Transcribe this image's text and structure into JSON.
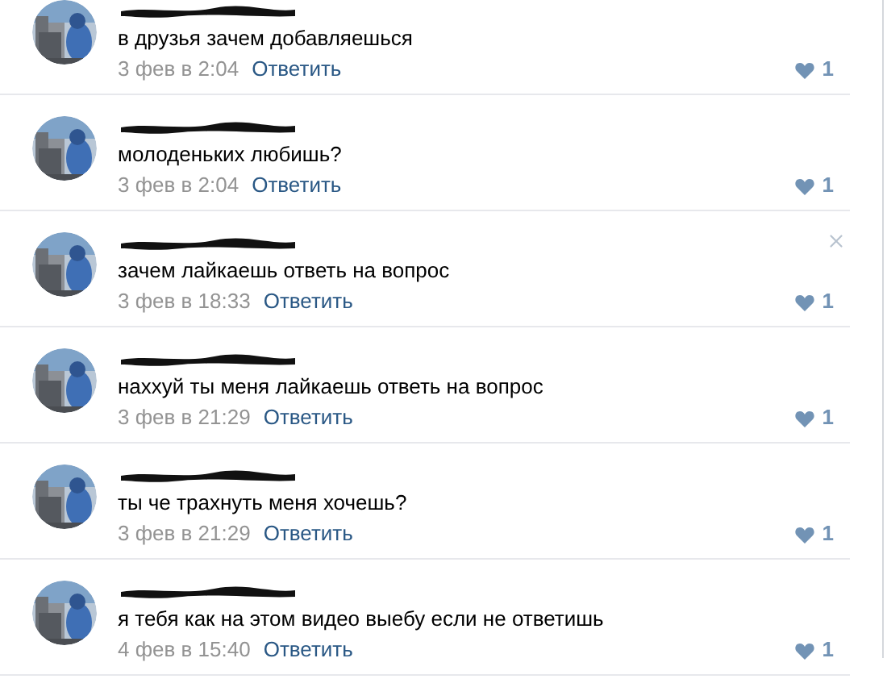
{
  "comments": [
    {
      "text": "в друзья зачем добавляешься",
      "date": "3 фев в 2:04",
      "reply": "Ответить",
      "likes": "1",
      "delete_shown": false
    },
    {
      "text": "молоденьких любишь?",
      "date": "3 фев в 2:04",
      "reply": "Ответить",
      "likes": "1",
      "delete_shown": false
    },
    {
      "text": "зачем лайкаешь ответь на вопрос",
      "date": "3 фев в 18:33",
      "reply": "Ответить",
      "likes": "1",
      "delete_shown": true
    },
    {
      "text": "наххуй ты меня лайкаешь ответь на вопрос",
      "date": "3 фев в 21:29",
      "reply": "Ответить",
      "likes": "1",
      "delete_shown": false
    },
    {
      "text": "ты че трахнуть меня хочешь?",
      "date": "3 фев в 21:29",
      "reply": "Ответить",
      "likes": "1",
      "delete_shown": false
    },
    {
      "text": "я тебя как на этом видео выебу если не ответишь",
      "date": "4 фев в 15:40",
      "reply": "Ответить",
      "likes": "1",
      "delete_shown": false
    }
  ]
}
